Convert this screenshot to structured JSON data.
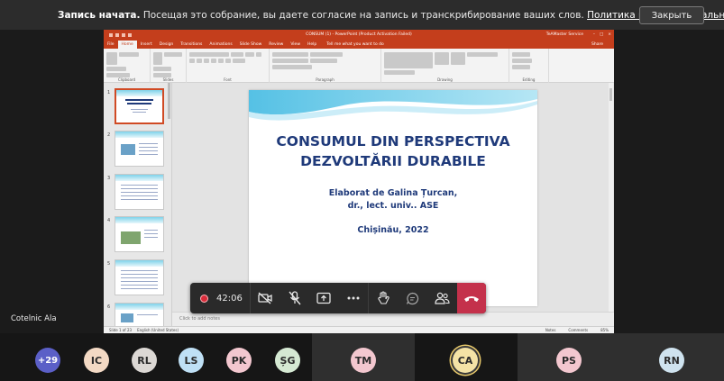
{
  "banner": {
    "bold": "Запись начата.",
    "text": " Посещая это собрание, вы даете согласие на запись и транскрибирование ваших слов. ",
    "link": "Политика конфиденциальности",
    "close": "Закрыть"
  },
  "ppt": {
    "window_title": "CONSUM (1) - PowerPoint (Product Activation Failed)",
    "user": "TeAMaster Service",
    "tabs": [
      "File",
      "Home",
      "Insert",
      "Design",
      "Transitions",
      "Animations",
      "Slide Show",
      "Review",
      "View",
      "Help"
    ],
    "tell_me": "Tell me what you want to do",
    "share": "Share",
    "groups": [
      "Clipboard",
      "Slides",
      "Font",
      "Paragraph",
      "Drawing",
      "Editing"
    ],
    "thumb_numbers": [
      "1",
      "2",
      "3",
      "4",
      "5",
      "6"
    ],
    "slide": {
      "title_line1": "CONSUMUL DIN PERSPECTIVA",
      "title_line2": "DEZVOLTĂRII DURABILE",
      "author_line1": "Elaborat de Galina Țurcan,",
      "author_line2": "dr., lect. univ.. ASE",
      "city_year": "Chișinău, 2022"
    },
    "notes_placeholder": "Click to add notes",
    "status": {
      "slide_count": "Slide 1 of 23",
      "language": "English (United States)",
      "notes": "Notes",
      "comments": "Comments",
      "zoom": "85%"
    }
  },
  "call": {
    "timer": "42:06",
    "self_name": "Cotelnic Ala"
  },
  "participants": {
    "more": "+29",
    "list": [
      {
        "initials": "IC",
        "color": "#f3d9c4"
      },
      {
        "initials": "RL",
        "color": "#dcd8d4"
      },
      {
        "initials": "LS",
        "color": "#bfe0f5"
      },
      {
        "initials": "PK",
        "color": "#f3c7cf"
      },
      {
        "initials": "ȘG",
        "color": "#d5e9d3"
      },
      {
        "initials": "TM",
        "color": "#f3c7cf"
      },
      {
        "initials": "CA",
        "color": "#f4e3a6"
      },
      {
        "initials": "PS",
        "color": "#f3c7cf"
      },
      {
        "initials": "RN",
        "color": "#cfe3ef"
      }
    ]
  }
}
